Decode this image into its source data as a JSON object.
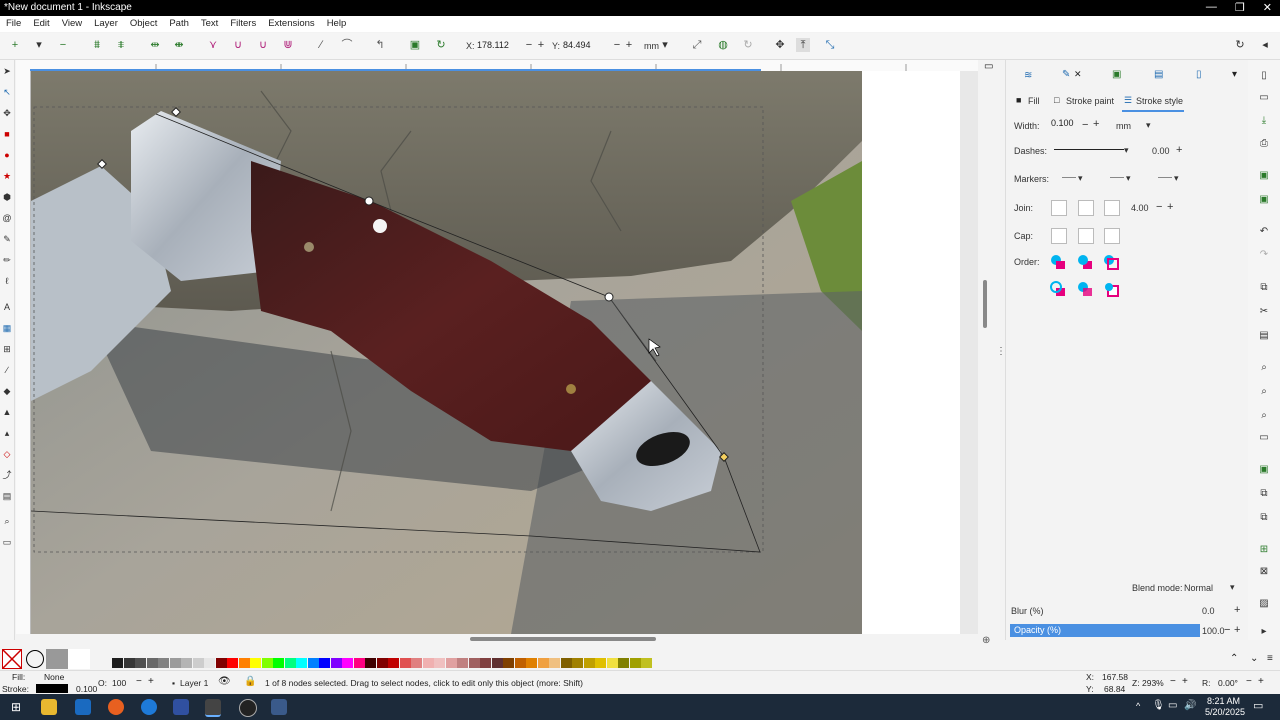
{
  "window": {
    "title": "*New document 1 - Inkscape",
    "minimize": "—",
    "restore": "❐",
    "close": "✕"
  },
  "menu": [
    "File",
    "Edit",
    "View",
    "Layer",
    "Object",
    "Path",
    "Text",
    "Filters",
    "Extensions",
    "Help"
  ],
  "toolbar": {
    "x_label": "X:",
    "x_value": "178.112",
    "y_label": "Y:",
    "y_value": "84.494",
    "unit": "mm"
  },
  "panel": {
    "tabs": {
      "fill": "Fill",
      "stroke_paint": "Stroke paint",
      "stroke_style": "Stroke style"
    },
    "width_label": "Width:",
    "width_value": "0.100",
    "width_unit": "mm",
    "dashes_label": "Dashes:",
    "dashes_value": "0.00",
    "markers_label": "Markers:",
    "join_label": "Join:",
    "join_value": "4.00",
    "cap_label": "Cap:",
    "order_label": "Order:",
    "blend_label": "Blend mode:",
    "blend_value": "Normal",
    "blur_label": "Blur (%)",
    "blur_value": "0.0",
    "opacity_label": "Opacity (%)",
    "opacity_value": "100.0"
  },
  "status": {
    "fill_label": "Fill:",
    "fill_value": "None",
    "stroke_label": "Stroke:",
    "stroke_width": "0.100",
    "opacity_label": "O:",
    "opacity_value": "100",
    "layer": "Layer 1",
    "message": "1 of 8 nodes selected. Drag to select nodes, click to edit only this object (more: Shift)",
    "cursor_x_label": "X:",
    "cursor_x": "167.58",
    "cursor_y_label": "Y:",
    "cursor_y": "68.84",
    "zoom_label": "Z:",
    "zoom": "293%",
    "rotation_label": "R:",
    "rotation": "0.00°"
  },
  "taskbar": {
    "time": "8:21 AM",
    "date": "5/20/2025"
  },
  "colors": {
    "accent": "#4a90e2",
    "taskbar": "#1c2a3a",
    "node_toolbar_green": "#2a7a2a",
    "order_cyan": "#00b4f0",
    "order_magenta": "#e6007e"
  }
}
